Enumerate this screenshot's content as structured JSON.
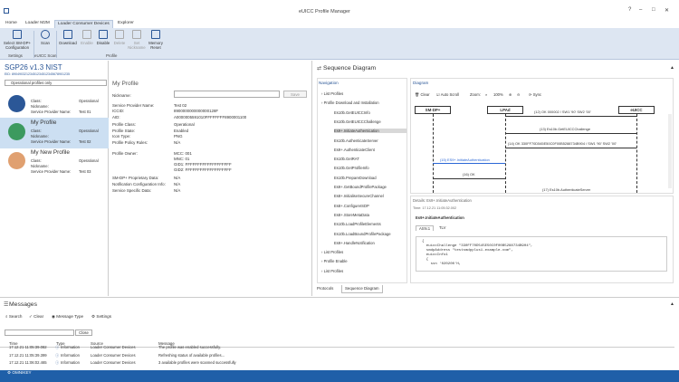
{
  "app": {
    "title": "eUICC Profile Manager",
    "status_label": "OMNIKEY"
  },
  "window_controls": {
    "help": "?",
    "minimize": "–",
    "maximize": "□",
    "close": "✕"
  },
  "menu_tabs": [
    "Home",
    "Loader M2M",
    "Loader Consumer Devices",
    "Explorer"
  ],
  "ribbon": {
    "buttons": [
      {
        "label": "Select SM-DP+ Configuration",
        "l1": "Select SM-DP+",
        "l2": "Configuration",
        "enabled": true
      },
      {
        "label": "Scan",
        "enabled": true
      },
      {
        "label": "Download",
        "enabled": true
      },
      {
        "label": "Enable",
        "enabled": false
      },
      {
        "label": "Disable",
        "enabled": true
      },
      {
        "label": "Delete",
        "enabled": false
      },
      {
        "label": "Set Nickname",
        "l1": "Set",
        "l2": "Nickname",
        "enabled": false
      },
      {
        "label": "Memory Reset",
        "l1": "Memory",
        "l2": "Reset",
        "enabled": true
      }
    ],
    "groups": [
      "Settings",
      "eUICC Scan",
      "Profile"
    ]
  },
  "device": {
    "name": "SGP26 v1.3 NIST",
    "eid": "EID: 89049032123451234512345678901235"
  },
  "profile_filter": {
    "selected": "Operational profiles only"
  },
  "profiles": [
    {
      "name": "",
      "class_label": "Class:",
      "class": "Operational",
      "nickname_label": "Nickname:",
      "nickname": "",
      "spn_label": "Service Provider Name:",
      "spn": "Test 01",
      "avatar_color": "#2b5797"
    },
    {
      "name": "My Profile",
      "class_label": "Class:",
      "class": "Operational",
      "nickname_label": "Nickname:",
      "nickname": "My Profile",
      "spn_label": "Service Provider Name:",
      "spn": "Test 02",
      "avatar_color": "#3c9a5f"
    },
    {
      "name": "My New Profile",
      "class_label": "Class:",
      "class": "Operational",
      "nickname_label": "Nickname:",
      "nickname": "My New Profile",
      "spn_label": "Service Provider Name:",
      "spn": "Test 03",
      "avatar_color": "#e0a070"
    }
  ],
  "details": {
    "title": "My Profile",
    "save_label": "Save",
    "fields": [
      {
        "label": "Nickname:",
        "value": ""
      },
      {
        "label": "Service Provider Name:",
        "value": "Test 02"
      },
      {
        "label": "ICCID:",
        "value": "8900000000000000128F"
      },
      {
        "label": "AID:",
        "value": "A0000005591010FFFFFFFF8900001100"
      },
      {
        "label": "Profile Class:",
        "value": "Operational"
      },
      {
        "label": "Profile State:",
        "value": "Enabled"
      },
      {
        "label": "Icon Type:",
        "value": "PNG"
      },
      {
        "label": "Profile Policy Rules:",
        "value": "N/A"
      },
      {
        "label": "Profile Owner:",
        "value": "MCC: 001"
      },
      {
        "label": "",
        "value": "MNC: 01"
      },
      {
        "label": "",
        "value": "GID1: FFFFFFFFFFFFFFFFFFF"
      },
      {
        "label": "",
        "value": "GID2: FFFFFFFFFFFFFFFFFFF"
      },
      {
        "label": "SM-DP+ Proprietary Data:",
        "value": "N/A"
      },
      {
        "label": "Notification Configuration Info:",
        "value": "N/A"
      },
      {
        "label": "Service Specific Data:",
        "value": "N/A"
      }
    ]
  },
  "sequence": {
    "title": "Sequence Diagram",
    "nav_title": "Navigation",
    "nav_items": [
      {
        "text": "List Profiles",
        "level": 0,
        "selected": false
      },
      {
        "text": "Profile Download and Installation",
        "level": 0,
        "selected": false
      },
      {
        "text": "Es10b.GetEUICCInfo",
        "level": 1,
        "selected": false
      },
      {
        "text": "Es10b.GetEUICCChallenge",
        "level": 1,
        "selected": false
      },
      {
        "text": "Es9+.InitiateAuthentication",
        "level": 1,
        "selected": true
      },
      {
        "text": "Es10b.AuthenticateServer",
        "level": 1,
        "selected": false
      },
      {
        "text": "Es9+.AuthenticateClient",
        "level": 1,
        "selected": false
      },
      {
        "text": "Es10b.GetRAT",
        "level": 1,
        "selected": false
      },
      {
        "text": "Es10b.GetProfileInfo",
        "level": 1,
        "selected": false
      },
      {
        "text": "Es10b.PrepareDownload",
        "level": 1,
        "selected": false
      },
      {
        "text": "Es9+.GetBoundProfilePackage",
        "level": 1,
        "selected": false
      },
      {
        "text": "Es8+.InitialiseSecureChannel",
        "level": 1,
        "selected": false
      },
      {
        "text": "Es8+.ConfigureISDP",
        "level": 1,
        "selected": false
      },
      {
        "text": "Es8+.StoreMetaData",
        "level": 1,
        "selected": false
      },
      {
        "text": "Es10b.LoadProfileElements",
        "level": 1,
        "selected": false
      },
      {
        "text": "Es10b.LoadBoundProfilePackage",
        "level": 1,
        "selected": false
      },
      {
        "text": "Es9+.HandleNotification",
        "level": 1,
        "selected": false
      },
      {
        "text": "List Profiles",
        "level": 0,
        "selected": false
      },
      {
        "text": "Profile Enable",
        "level": 0,
        "selected": false
      },
      {
        "text": "List Profiles",
        "level": 0,
        "selected": false
      }
    ],
    "diagram_title": "Diagram",
    "toolbar": {
      "clear": "Clear",
      "autoscroll": "Auto Scroll",
      "zoom": "Zoom:",
      "zoom_value": "100%",
      "sync": "Sync"
    },
    "actors": [
      "SM-DP+",
      "LPAd",
      "eUICC"
    ],
    "messages": [
      {
        "text": "(12) OK 000002 / SW1 '90' SW2 '00'"
      },
      {
        "text": "(13) Es10b.GetEUICCChallenge"
      },
      {
        "text": "(14) OK 330FF70D545E50C0F00B5288734B904 / SW1 '90' SW2 '00'"
      },
      {
        "text": "(15) ES9+.InitiateAuthentication"
      },
      {
        "text": "(16) OK"
      },
      {
        "text": "(17) Es10b.AuthenticateServer"
      }
    ],
    "details": {
      "header": "Details: Es9+.InitiateAuthentication",
      "time": "Time: 17.12.21 11:05:32.002",
      "name": "Es9+.InitiateAuthentication",
      "tabs": [
        "ASN.1",
        "TLV"
      ],
      "code_lines": [
        "{",
        "  euiccChallenge \"330FF70D545E50C0F00B5288734B904\",",
        "  smdpAddress \"testsmdpplus1.example.com\",",
        "  euiccInfo1",
        "  {",
        "    svn '020200'H,"
      ]
    },
    "bottom_tabs": [
      "Protocols",
      "Sequence Diagram"
    ]
  },
  "messages_panel": {
    "title": "Messages",
    "toolbar": {
      "search": "Search",
      "clear": "Clear",
      "type": "Message Type",
      "settings": "Settings"
    },
    "close_label": "Close",
    "columns": [
      "Time",
      "Type",
      "Source",
      "Message"
    ],
    "rows": [
      {
        "time": "17.12.21 11:05:39.082",
        "type": "Information",
        "source": "Loader Consumer Devices",
        "message": "The profile was enabled successfully."
      },
      {
        "time": "17.12.21 11:05:39.399",
        "type": "Information",
        "source": "Loader Consumer Devices",
        "message": "Refreshing status of available profiles..."
      },
      {
        "time": "17.12.21 11:06:02.465",
        "type": "Information",
        "source": "Loader Consumer Devices",
        "message": "3 available profiles were scanned successfully"
      }
    ]
  },
  "colors": {
    "accent": "#2b5797",
    "ribbon": "#dde6f2",
    "status": "#1f5fa8",
    "selected": "#ccdff2"
  }
}
